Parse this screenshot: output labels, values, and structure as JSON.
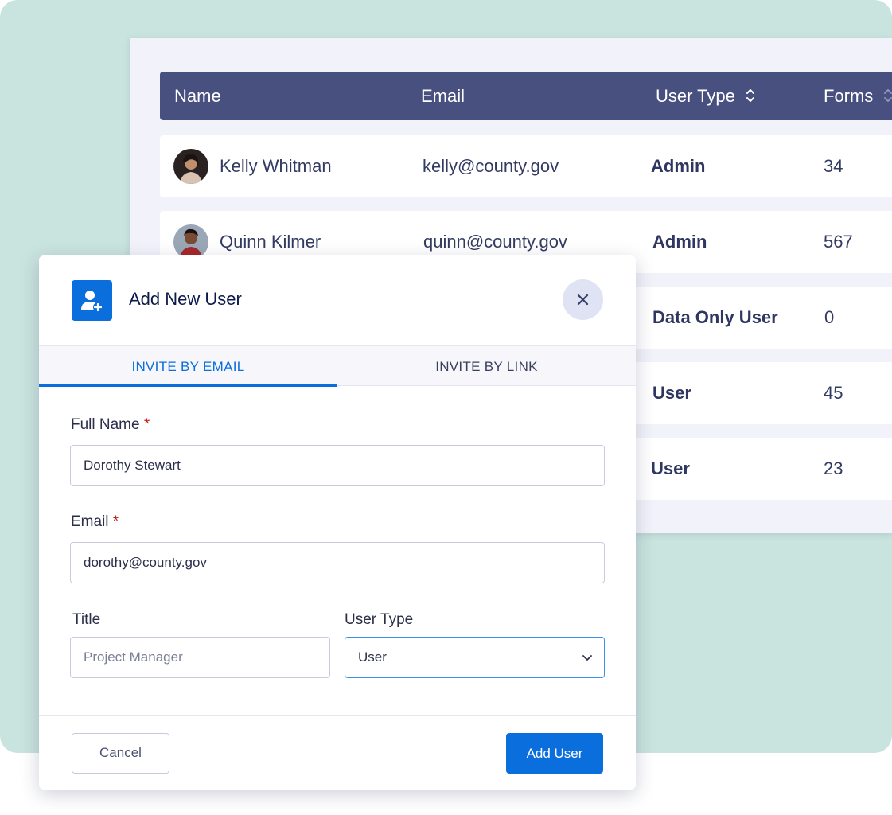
{
  "table": {
    "columns": [
      "Name",
      "Email",
      "User Type",
      "Forms"
    ],
    "rows": [
      {
        "name": "Kelly Whitman",
        "email": "kelly@county.gov",
        "type": "Admin",
        "forms": "34"
      },
      {
        "name": "Quinn Kilmer",
        "email": "quinn@county.gov",
        "type": "Admin",
        "forms": "567"
      },
      {
        "name": "",
        "email": "",
        "type": "Data Only User",
        "forms": "0"
      },
      {
        "name": "",
        "email": "",
        "type": "User",
        "forms": "45"
      },
      {
        "name": "",
        "email": "",
        "type": "User",
        "forms": "23"
      }
    ]
  },
  "modal": {
    "title": "Add New User",
    "tabs": [
      "INVITE BY EMAIL",
      "INVITE BY LINK"
    ],
    "full_name": {
      "label": "Full Name",
      "required_mark": "*",
      "value": "Dorothy Stewart"
    },
    "email": {
      "label": "Email",
      "required_mark": "*",
      "value": "dorothy@county.gov"
    },
    "title_field": {
      "label": "Title",
      "placeholder": "Project Manager"
    },
    "user_type": {
      "label": "User Type",
      "value": "User"
    },
    "cancel_label": "Cancel",
    "add_label": "Add User"
  },
  "colors": {
    "accent": "#0a6fdc",
    "header": "#48507f",
    "background": "#c9e3de"
  },
  "icons": {
    "modal": "user-plus-icon",
    "close": "close-icon",
    "sort": "sort-icon",
    "chevron": "chevron-down-icon"
  }
}
